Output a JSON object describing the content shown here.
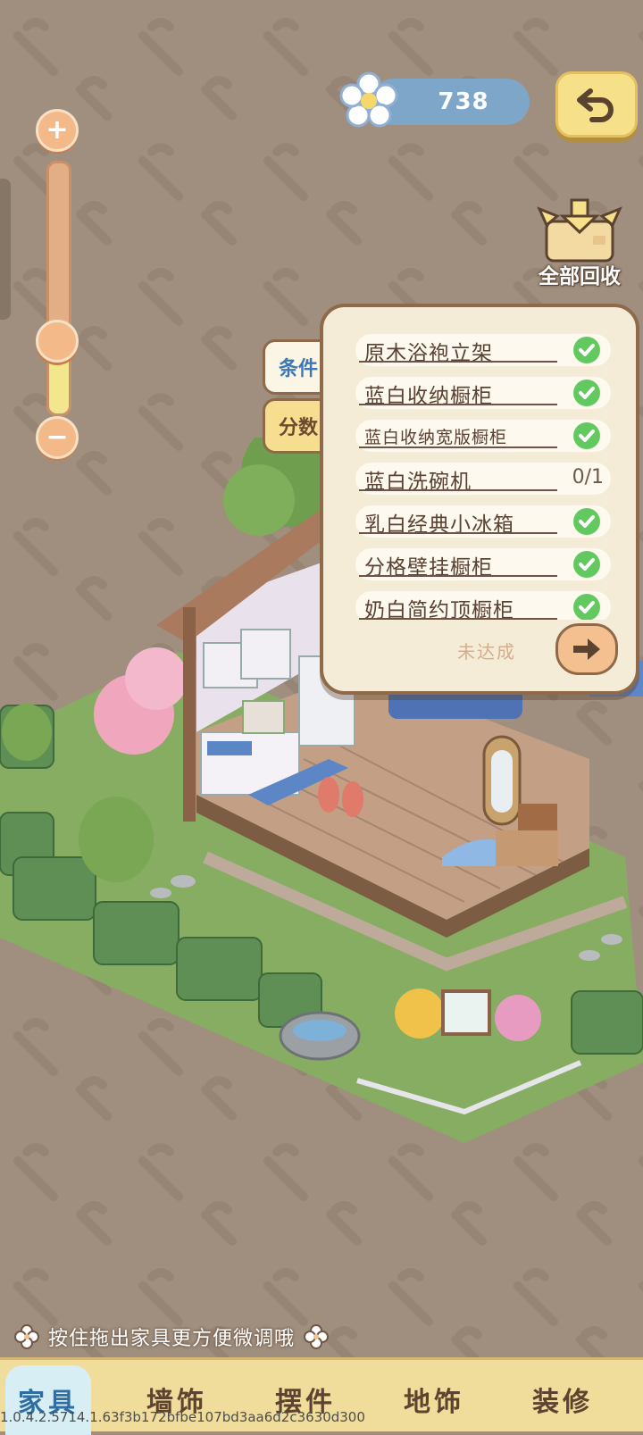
{
  "currency": {
    "value": "738",
    "icon": "flower-icon"
  },
  "top_right": {
    "back_icon": "undo-arrow-icon"
  },
  "zoom": {
    "plus": "+",
    "minus": "−",
    "level": 0.85
  },
  "recycle": {
    "label": "全部回收",
    "icon": "box-recycle-icon"
  },
  "panel": {
    "tabs": [
      {
        "label": "条件",
        "active": true
      },
      {
        "label": "分数",
        "active": false
      }
    ],
    "conditions": [
      {
        "name": "原木浴袍立架",
        "done": true
      },
      {
        "name": "蓝白收纳橱柜",
        "done": true
      },
      {
        "name": "蓝白收纳宽版橱柜",
        "done": true
      },
      {
        "name": "蓝白洗碗机",
        "done": false,
        "progress": "0/1"
      },
      {
        "name": "乳白经典小冰箱",
        "done": true
      },
      {
        "name": "分格壁挂橱柜",
        "done": true
      },
      {
        "name": "奶白简约顶橱柜",
        "done": true
      }
    ],
    "status": "未达成"
  },
  "hint": "按住拖出家具更方便微调哦",
  "bottom_tabs": [
    {
      "label": "家具",
      "active": true
    },
    {
      "label": "墙饰",
      "active": false
    },
    {
      "label": "摆件",
      "active": false
    },
    {
      "label": "地饰",
      "active": false
    },
    {
      "label": "装修",
      "active": false
    }
  ],
  "version": "1.0.4.2.5714.1.63f3b172bfbe107bd3aa6d2c3630d300",
  "colors": {
    "background": "#a08f7f",
    "accent_blue": "#7ea6c8",
    "check_green": "#62c960",
    "tabbar": "#f0dd9b"
  }
}
